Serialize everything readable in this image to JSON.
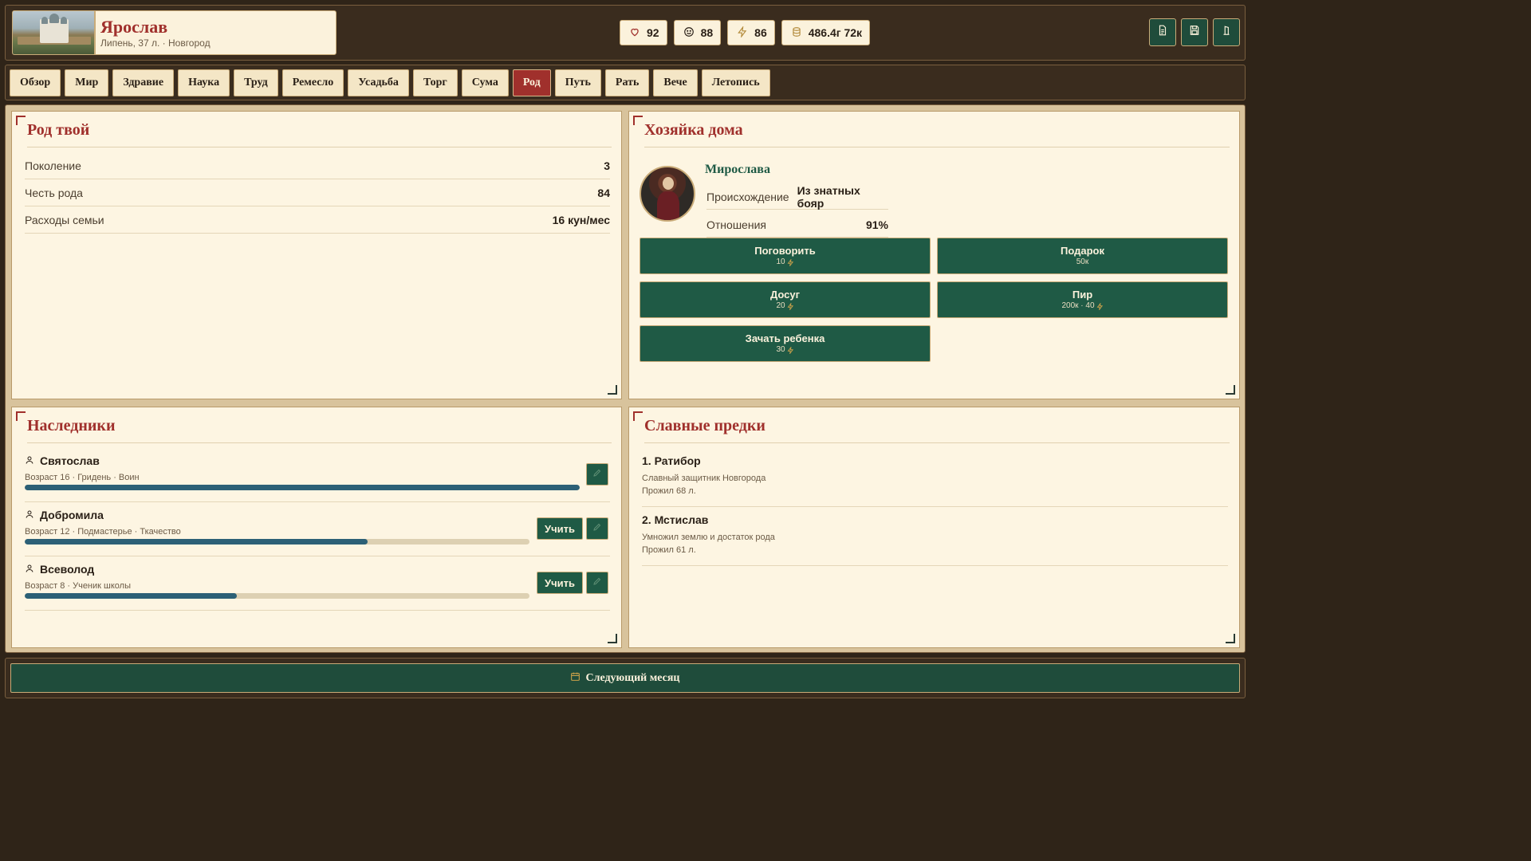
{
  "player": {
    "name": "Ярослав",
    "subtitle": "Липень, 37 л. · Новгород"
  },
  "stats": [
    {
      "icon": "heart-icon",
      "value": "92"
    },
    {
      "icon": "smile-icon",
      "value": "88"
    },
    {
      "icon": "lightning-icon",
      "value": "86"
    },
    {
      "icon": "coins-icon",
      "value": "486.4г 72к"
    }
  ],
  "header_buttons": [
    "document-icon",
    "save-icon",
    "exit-icon"
  ],
  "tabs": [
    "Обзор",
    "Мир",
    "Здравие",
    "Наука",
    "Труд",
    "Ремесло",
    "Усадьба",
    "Торг",
    "Сума",
    "Род",
    "Путь",
    "Рать",
    "Вече",
    "Летопись"
  ],
  "active_tab": "Род",
  "family": {
    "title": "Род твой",
    "rows": [
      {
        "label": "Поколение",
        "value": "3"
      },
      {
        "label": "Честь рода",
        "value": "84"
      },
      {
        "label": "Расходы семьи",
        "value": "16 кун/мес"
      }
    ]
  },
  "wife": {
    "title": "Хозяйка дома",
    "name": "Мирослава",
    "origin_label": "Происхождение",
    "origin_value": "Из знатных бояр",
    "relation_label": "Отношения",
    "relation_value": "91%",
    "actions": [
      {
        "label": "Поговорить",
        "cost": "10"
      },
      {
        "label": "Подарок",
        "cost": "50к"
      },
      {
        "label": "Досуг",
        "cost": "20"
      },
      {
        "label": "Пир",
        "cost": "200к · 40"
      },
      {
        "label": "Зачать ребенка",
        "cost": "30"
      }
    ]
  },
  "heirs": {
    "title": "Наследники",
    "teach_label": "Учить",
    "items": [
      {
        "name": "Святослав",
        "sub": "Возраст 16 · Гридень · Воин",
        "progress": 1.0,
        "can_teach": false
      },
      {
        "name": "Добромила",
        "sub": "Возраст 12 · Подмастерье · Ткачество",
        "progress": 0.68,
        "can_teach": true
      },
      {
        "name": "Всеволод",
        "sub": "Возраст 8 · Ученик школы",
        "progress": 0.42,
        "can_teach": true
      }
    ]
  },
  "ancestors": {
    "title": "Славные предки",
    "items": [
      {
        "title": "1. Ратибор",
        "desc": "Славный защитник Новгорода",
        "lived": "Прожил 68 л."
      },
      {
        "title": "2. Мстислав",
        "desc": "Умножил землю и достаток рода",
        "lived": "Прожил 61 л."
      }
    ]
  },
  "footer": {
    "next_label": "Следующий месяц"
  },
  "colors": {
    "accent_red": "#a0302c",
    "accent_green": "#1f5a45",
    "progress_blue": "#2c6076",
    "parchment": "#fdf5e2"
  }
}
